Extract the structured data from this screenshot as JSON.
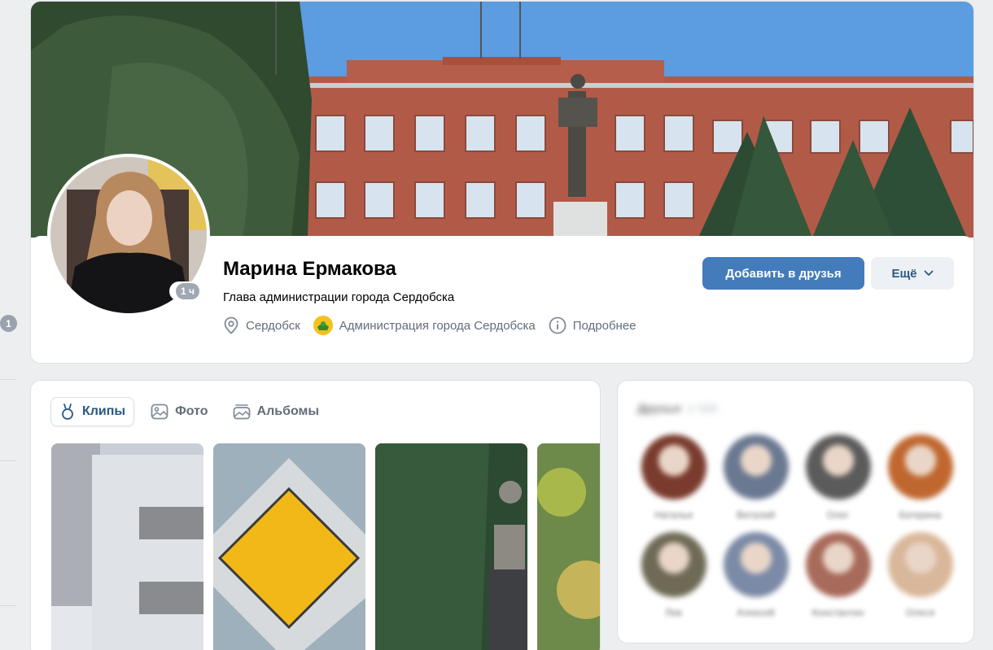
{
  "sidebar": {
    "badge": "1"
  },
  "profile": {
    "name": "Марина Ермакова",
    "status": "Глава администрации города Сердобска",
    "online": "1 ч",
    "location": "Сердобск",
    "work": "Администрация города Сердобска",
    "details": "Подробнее",
    "add_friend": "Добавить в друзья",
    "more": "Ещё"
  },
  "media": {
    "tabs": [
      {
        "label": "Клипы",
        "icon": "clips-icon"
      },
      {
        "label": "Фото",
        "icon": "photo-icon"
      },
      {
        "label": "Альбомы",
        "icon": "albums-icon"
      }
    ]
  },
  "friends": {
    "title": "Друзья",
    "count": "1 566",
    "items": [
      {
        "name": "Наталья",
        "color": "#7a3b2e"
      },
      {
        "name": "Виталий",
        "color": "#6a7891"
      },
      {
        "name": "Олег",
        "color": "#5b5b5b"
      },
      {
        "name": "Катерина",
        "color": "#c0672f"
      },
      {
        "name": "Лев",
        "color": "#6e6a55"
      },
      {
        "name": "Алексей",
        "color": "#7b8aa6"
      },
      {
        "name": "Константин",
        "color": "#a86a5a"
      },
      {
        "name": "Олеся",
        "color": "#d9b79a"
      }
    ]
  },
  "colors": {
    "accent": "#447bba",
    "link": "#2a5885",
    "secondary_text": "#626d7a",
    "page_bg": "#edeef0"
  }
}
